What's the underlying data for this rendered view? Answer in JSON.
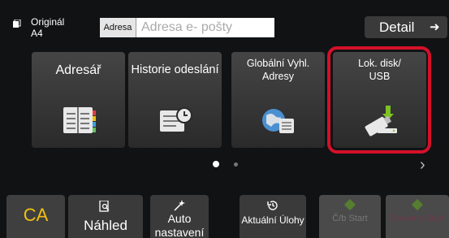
{
  "original": {
    "label": "Originál",
    "size": "A4"
  },
  "address": {
    "button_label": "Adresa",
    "placeholder": "Adresa e- pošty",
    "value": ""
  },
  "detail": {
    "label": "Detail",
    "arrow": "➜"
  },
  "tiles": [
    {
      "label": "Adresář",
      "icon": "address-book-icon"
    },
    {
      "label": "Historie odeslání",
      "icon": "send-history-icon"
    },
    {
      "label": "Globální Vyhl. Adresy",
      "icon": "global-address-search-icon"
    },
    {
      "label": "Lok. disk/ USB",
      "icon": "usb-storage-icon",
      "highlighted": true
    }
  ],
  "pager": {
    "pages": 2,
    "current": 1,
    "next": "›"
  },
  "bottom": {
    "ca": "CA",
    "preview": "Náhled",
    "auto": "Auto nastavení",
    "tasks": "Aktuální Úlohy",
    "start_bw": "Č/b Start",
    "start_color": "Barevný Start"
  },
  "colors": {
    "accent": "#d5102a",
    "ca": "#f0c010",
    "icon_blue": "#4a90d0",
    "icon_green": "#7cc322"
  }
}
